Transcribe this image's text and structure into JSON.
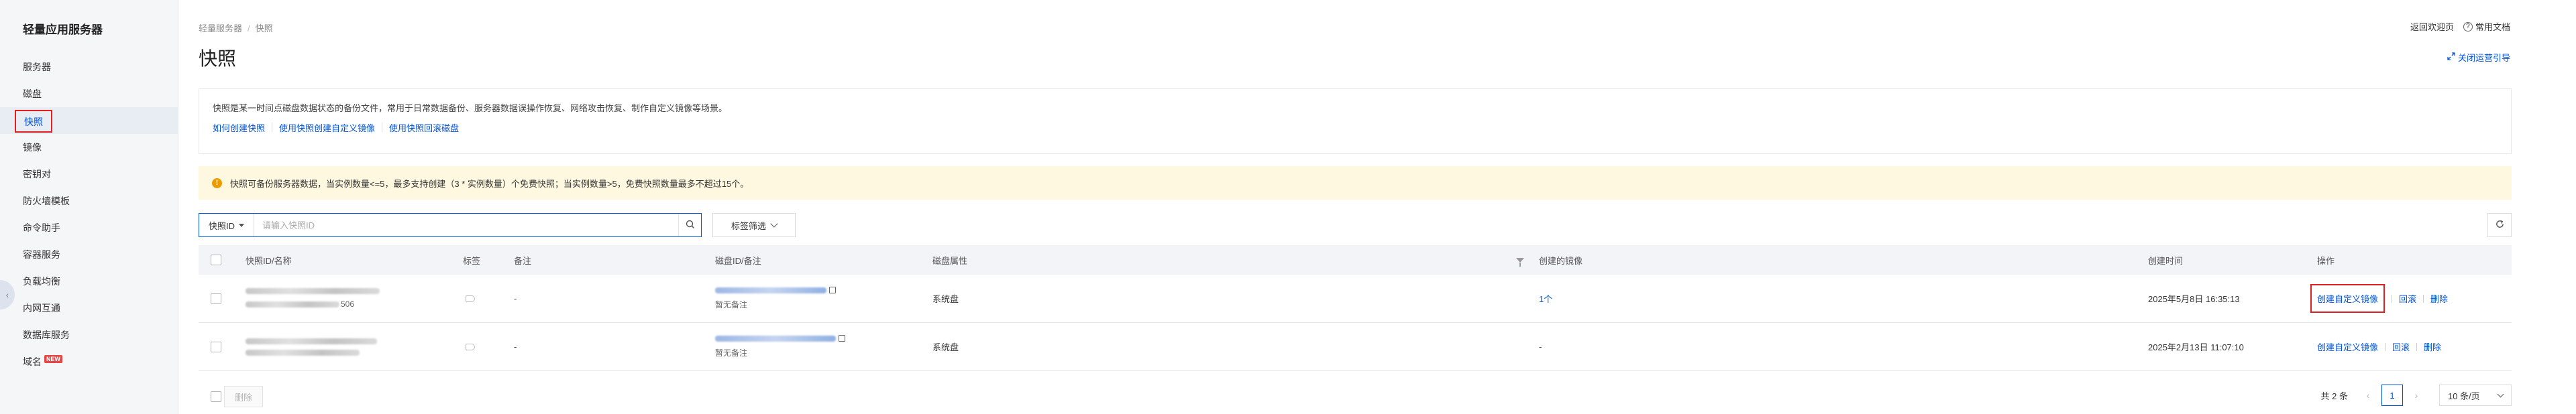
{
  "app": {
    "title": "轻量应用服务器"
  },
  "sidebar": {
    "items": [
      {
        "label": "服务器"
      },
      {
        "label": "磁盘"
      },
      {
        "label": "快照"
      },
      {
        "label": "镜像"
      },
      {
        "label": "密钥对"
      },
      {
        "label": "防火墙模板"
      },
      {
        "label": "命令助手"
      },
      {
        "label": "容器服务"
      },
      {
        "label": "负载均衡"
      },
      {
        "label": "内网互通"
      },
      {
        "label": "数据库服务"
      },
      {
        "label": "域名",
        "badge": "NEW"
      }
    ],
    "active_index": 2
  },
  "breadcrumb": {
    "parent": "轻量服务器",
    "sep": "/",
    "current": "快照"
  },
  "header": {
    "title": "快照",
    "back_welcome": "返回欢迎页",
    "docs": "常用文档",
    "close_guide": "关闭运营引导"
  },
  "intro": {
    "text": "快照是某一时间点磁盘数据状态的备份文件，常用于日常数据备份、服务器数据误操作恢复、网络攻击恢复、制作自定义镜像等场景。",
    "links": [
      "如何创建快照",
      "使用快照创建自定义镜像",
      "使用快照回滚磁盘"
    ]
  },
  "notice": {
    "icon": "warning-icon",
    "text": "快照可备份服务器数据，当实例数量<=5，最多支持创建（3 * 实例数量）个免费快照；当实例数量>5，免费快照数量最多不超过15个。"
  },
  "toolbar": {
    "search_type": "快照ID",
    "search_placeholder": "请输入快照ID",
    "tag_filter": "标签筛选"
  },
  "table": {
    "columns": {
      "id_name": "快照ID/名称",
      "tag": "标签",
      "remark": "备注",
      "disk": "磁盘ID/备注",
      "disk_attr": "磁盘属性",
      "images": "创建的镜像",
      "created": "创建时间",
      "ops": "操作"
    },
    "rows": [
      {
        "id_suffix": "506",
        "remark": "-",
        "disk_remark": "暂无备注",
        "disk_attr": "系统盘",
        "images": "1个",
        "created": "2025年5月8日 16:35:13",
        "op_create": "创建自定义镜像",
        "op_rollback": "回滚",
        "op_delete": "删除"
      },
      {
        "id_suffix": "",
        "remark": "-",
        "disk_remark": "暂无备注",
        "disk_attr": "系统盘",
        "images": "-",
        "created": "2025年2月13日 11:07:10",
        "op_create": "创建自定义镜像",
        "op_rollback": "回滚",
        "op_delete": "删除"
      }
    ]
  },
  "footer": {
    "delete": "删除",
    "total": "共 2 条",
    "page": "1",
    "page_size": "10 条/页"
  },
  "colors": {
    "accent": "#0052d9",
    "highlight": "#e02020",
    "notice_bg": "#fff8e1",
    "warn": "#ed9b00"
  }
}
